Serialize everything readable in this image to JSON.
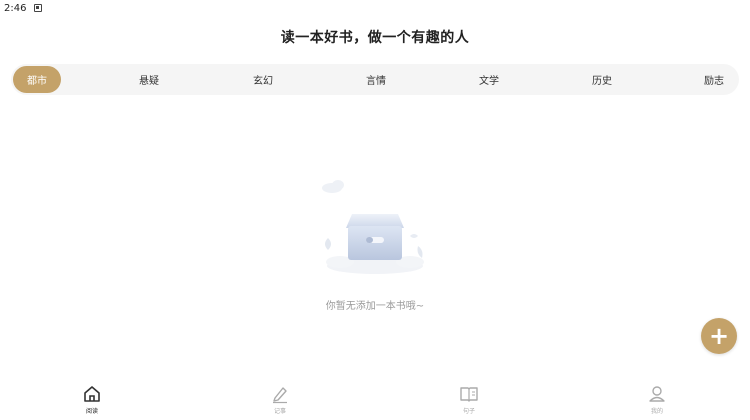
{
  "statusbar": {
    "time": "2:46"
  },
  "header": {
    "title": "读一本好书，做一个有趣的人"
  },
  "tabs": [
    {
      "label": "都市",
      "active": true
    },
    {
      "label": "悬疑",
      "active": false
    },
    {
      "label": "玄幻",
      "active": false
    },
    {
      "label": "言情",
      "active": false
    },
    {
      "label": "文学",
      "active": false
    },
    {
      "label": "历史",
      "active": false
    },
    {
      "label": "励志",
      "active": false
    }
  ],
  "empty_state": {
    "message": "你暂无添加一本书哦~",
    "icon": "empty-box-icon"
  },
  "fab": {
    "icon": "plus-icon",
    "symbol": "+"
  },
  "bottom_nav": [
    {
      "label": "阅读",
      "icon": "home-icon",
      "active": true
    },
    {
      "label": "记事",
      "icon": "pen-icon",
      "active": false
    },
    {
      "label": "句子",
      "icon": "book-icon",
      "active": false
    },
    {
      "label": "我的",
      "icon": "user-icon",
      "active": false
    }
  ],
  "colors": {
    "accent": "#c4a269",
    "tab_bar_bg": "#f5f5f5",
    "muted_text": "#9a9a9a"
  }
}
